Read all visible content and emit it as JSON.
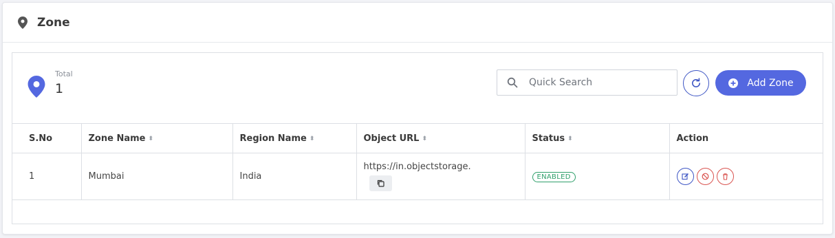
{
  "header": {
    "title": "Zone",
    "icon": "map-pin-icon"
  },
  "stats": {
    "label": "Total",
    "value": "1",
    "icon": "map-pin-icon"
  },
  "search": {
    "placeholder": "Quick Search",
    "value": ""
  },
  "buttons": {
    "add_label": "Add Zone",
    "refresh_icon": "refresh-icon",
    "add_icon": "plus-circle-icon"
  },
  "colors": {
    "accent": "#5468e0",
    "refresh_border": "#3d55c4",
    "enabled": "#2e9f6a",
    "danger": "#d9534f"
  },
  "table": {
    "columns": [
      {
        "label": "S.No",
        "sortable": false
      },
      {
        "label": "Zone Name",
        "sortable": true
      },
      {
        "label": "Region Name",
        "sortable": true
      },
      {
        "label": "Object URL",
        "sortable": true
      },
      {
        "label": "Status",
        "sortable": true
      },
      {
        "label": "Action",
        "sortable": false
      }
    ],
    "rows": [
      {
        "sno": "1",
        "zone_name": "Mumbai",
        "region_name": "India",
        "object_url": "https://in.objectstorage.",
        "status": "ENABLED"
      }
    ]
  }
}
